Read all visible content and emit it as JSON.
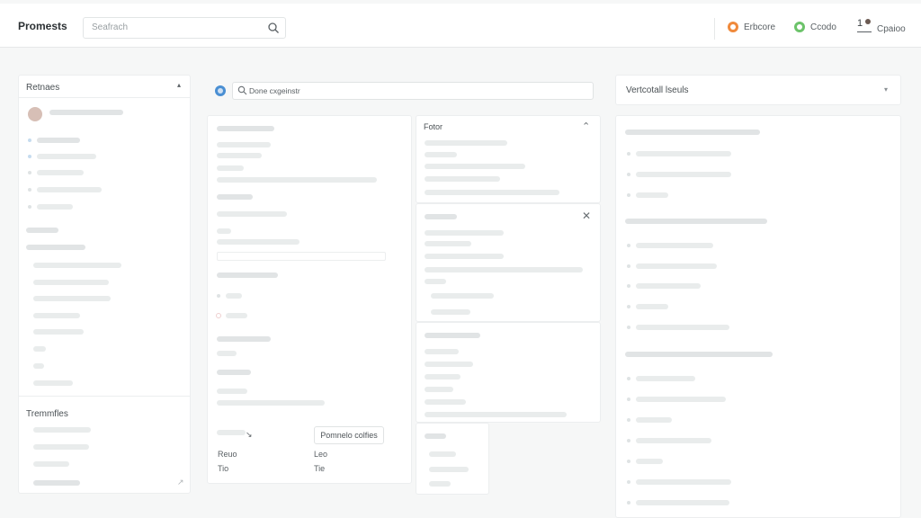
{
  "app": {
    "title": "Promests"
  },
  "search": {
    "placeholder": "Seafrach"
  },
  "topbar_actions": [
    {
      "label": "Erbcore",
      "icon": "orange-circle-icon",
      "color": "#f08a3c"
    },
    {
      "label": "Ccodo",
      "icon": "green-circle-icon",
      "color": "#6cc36a"
    },
    {
      "label": "Cpaioo",
      "icon": "user-notification-icon",
      "badge": "1"
    }
  ],
  "left_panel": {
    "title": "Retnaes",
    "templates_title": "Tremmfles"
  },
  "center_search": {
    "placeholder": "Done cxgeinstr"
  },
  "center_left": {
    "buttons": {
      "primary": "Pomnelo colfies"
    },
    "table": {
      "col_a": [
        "Reuo",
        "Tio"
      ],
      "col_b": [
        "Leo",
        "Tie"
      ]
    }
  },
  "center_right": {
    "title": "Fotor"
  },
  "right_panel": {
    "dropdown": "Vertcotall lseuls"
  },
  "colors": {
    "accent": "#4a8fd3",
    "panel": "#ffffff",
    "bg": "#f6f7f7"
  }
}
